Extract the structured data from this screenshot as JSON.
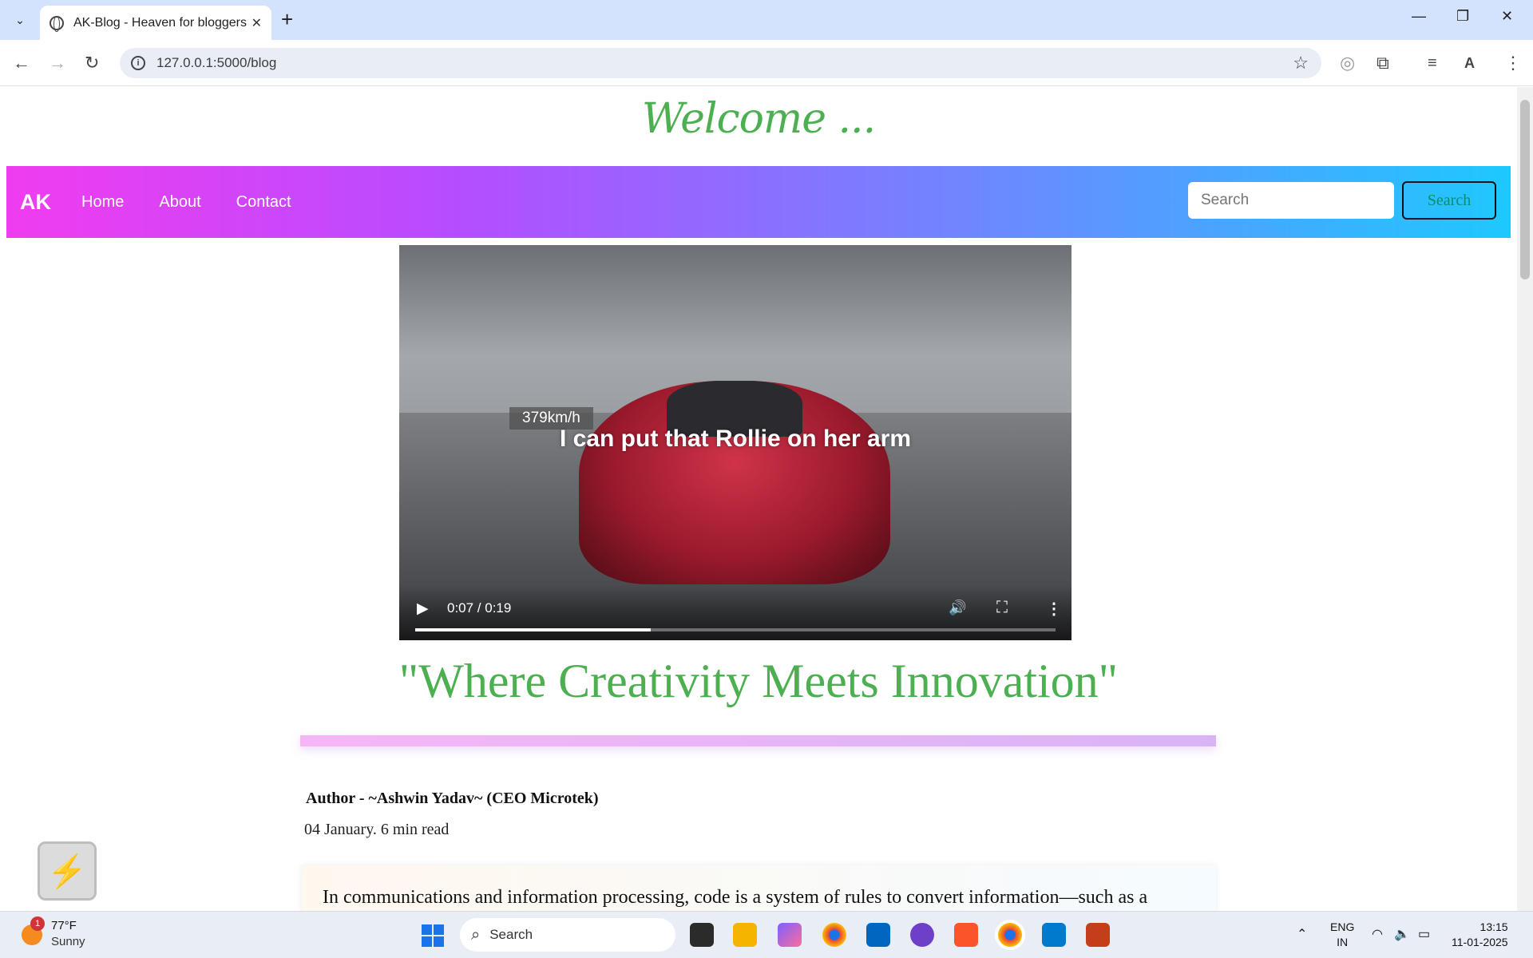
{
  "browser": {
    "tab_title": "AK-Blog - Heaven for bloggers",
    "new_tab_label": "+",
    "url": "127.0.0.1:5000/blog"
  },
  "page": {
    "welcome": "Welcome ...",
    "brand": "AK",
    "nav": [
      {
        "label": "Home"
      },
      {
        "label": "About"
      },
      {
        "label": "Contact"
      }
    ],
    "search": {
      "placeholder": "Search",
      "button_label": "Search"
    },
    "video": {
      "speed_overlay": "379km/h",
      "caption": "I can put that Rollie on her arm",
      "time": "0:07 / 0:19",
      "progress_fraction": 0.368
    },
    "tagline": "\"Where Creativity Meets Innovation\"",
    "author": "Author - ~Ashwin Yadav~ (CEO Microtek)",
    "date": "04 January. 6 min read",
    "article_text": "In communications and information processing, code is a system of rules to convert information—such as a"
  },
  "taskbar": {
    "weather_temp": "77°F",
    "weather_cond": "Sunny",
    "weather_badge": "1",
    "search_label": "Search",
    "lang_line1": "ENG",
    "lang_line2": "IN",
    "time": "13:15",
    "date": "11-01-2025"
  },
  "colors": {
    "accent_green": "#4caf50",
    "nav_gradient_start": "#f13cf0",
    "nav_gradient_end": "#1ec8ff"
  }
}
